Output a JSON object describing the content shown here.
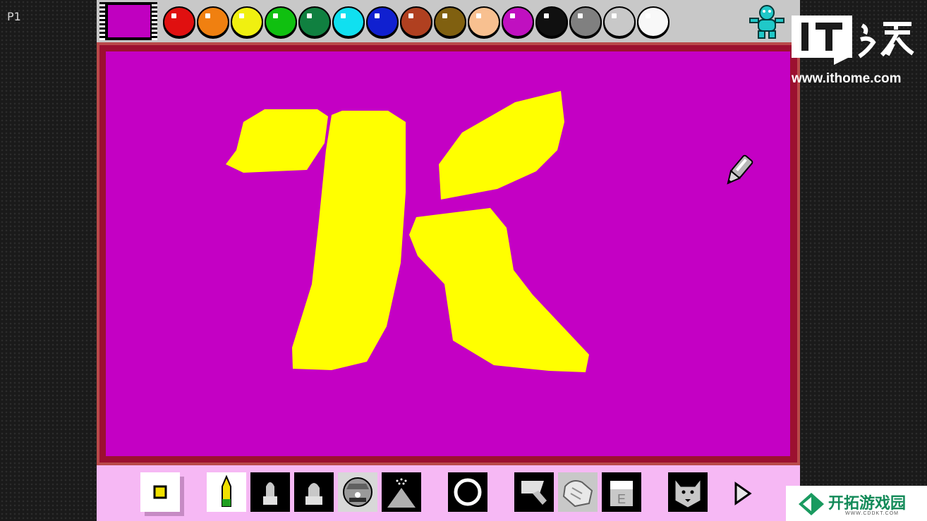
{
  "player_label": "P1",
  "current_color": "#c000c0",
  "palette": [
    {
      "name": "red",
      "hex": "#e01010"
    },
    {
      "name": "orange",
      "hex": "#f08010"
    },
    {
      "name": "yellow",
      "hex": "#f0f010"
    },
    {
      "name": "green",
      "hex": "#10c010"
    },
    {
      "name": "dark-green",
      "hex": "#108040"
    },
    {
      "name": "cyan",
      "hex": "#10e0f0"
    },
    {
      "name": "blue",
      "hex": "#1020d0"
    },
    {
      "name": "brown-red",
      "hex": "#b04020"
    },
    {
      "name": "olive-brown",
      "hex": "#806010"
    },
    {
      "name": "peach",
      "hex": "#f8c090"
    },
    {
      "name": "purple",
      "hex": "#c010c0"
    },
    {
      "name": "black",
      "hex": "#101010"
    },
    {
      "name": "gray",
      "hex": "#808080"
    },
    {
      "name": "light-gray",
      "hex": "#c8c8c8"
    },
    {
      "name": "white",
      "hex": "#f8f8f8"
    }
  ],
  "canvas": {
    "background": "#c400c4",
    "drawing_color": "#ffff00"
  },
  "toolbar_tools": [
    "brush-size-tool",
    "pencil-tool",
    "stamp-tool",
    "stamp-alt-tool",
    "mario-stamp-tool",
    "spray-tool",
    "circle-tool",
    "paint-bucket-tool",
    "undo-hand-tool",
    "eraser-tool",
    "undo-dog-tool",
    "next-arrow-button"
  ],
  "watermark": {
    "logo": "IT之家",
    "site": "www.ithome.com"
  },
  "badge": {
    "title": "开拓游戏园",
    "subtitle": "WWW.CDDKT.COM"
  }
}
